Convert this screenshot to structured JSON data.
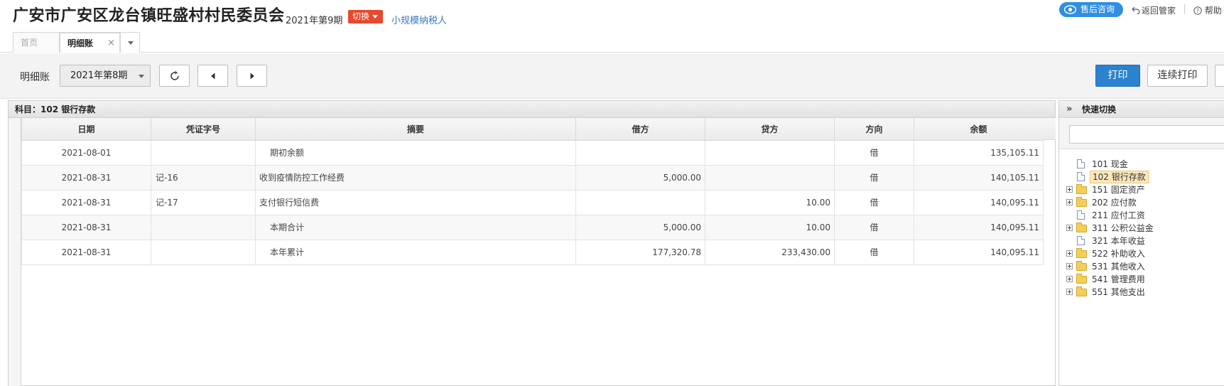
{
  "header": {
    "org_title": "广安市广安区龙台镇旺盛村村民委员会",
    "current_period": "2021年第9期",
    "switch_label": "切换",
    "taxpayer_type": "小规模纳税人",
    "service_label": "售后咨询",
    "back_label": "返回管家",
    "help_label": "帮助"
  },
  "tabs": [
    {
      "label": "首页"
    },
    {
      "label": "明细账",
      "close": "×"
    }
  ],
  "toolbar": {
    "label": "明细账",
    "period_value": "2021年第8期",
    "print_label": "打印",
    "continuous_print_label": "连续打印"
  },
  "ledger": {
    "subject": "科目：102 银行存款",
    "columns": [
      "日期",
      "凭证字号",
      "摘要",
      "借方",
      "贷方",
      "方向",
      "余额"
    ],
    "rows": [
      {
        "date": "2021-08-01",
        "voucher": "",
        "summary": "期初余额",
        "debit": "",
        "credit": "",
        "dir": "借",
        "balance": "135,105.11"
      },
      {
        "date": "2021-08-31",
        "voucher": "记-16",
        "summary": "收到疫情防控工作经费",
        "debit": "5,000.00",
        "credit": "",
        "dir": "借",
        "balance": "140,105.11"
      },
      {
        "date": "2021-08-31",
        "voucher": "记-17",
        "summary": "支付银行短信费",
        "debit": "",
        "credit": "10.00",
        "dir": "借",
        "balance": "140,095.11"
      },
      {
        "date": "2021-08-31",
        "voucher": "",
        "summary": "本期合计",
        "debit": "5,000.00",
        "credit": "10.00",
        "dir": "借",
        "balance": "140,095.11"
      },
      {
        "date": "2021-08-31",
        "voucher": "",
        "summary": "本年累计",
        "debit": "177,320.78",
        "credit": "233,430.00",
        "dir": "借",
        "balance": "140,095.11"
      }
    ]
  },
  "quick_switch": {
    "title": "快速切换",
    "chevron": "»",
    "items": [
      {
        "label": "101 现金"
      },
      {
        "label": "102 银行存款"
      },
      {
        "label": "151 固定资产"
      },
      {
        "label": "202 应付款"
      },
      {
        "label": "211 应付工资"
      },
      {
        "label": "311 公积公益金"
      },
      {
        "label": "321 本年收益"
      },
      {
        "label": "522 补助收入"
      },
      {
        "label": "531 其他收入"
      },
      {
        "label": "541 管理费用"
      },
      {
        "label": "551 其他支出"
      }
    ]
  },
  "colors": {
    "switch_bg": "#e8482b",
    "service_bg": "#2f8fe0",
    "print_bg": "#2b82cf",
    "link": "#3a77c0",
    "selected_bg": "#fde8bd"
  }
}
